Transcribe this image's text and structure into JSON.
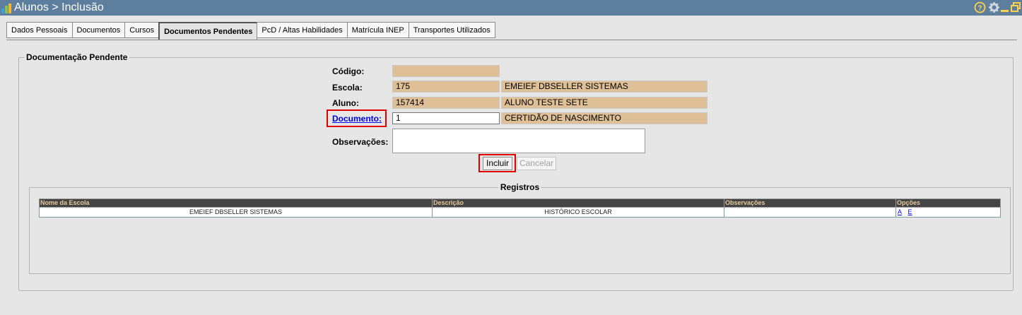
{
  "window": {
    "title": "Alunos > Inclusão",
    "bar_color": "#5d7f9d"
  },
  "tabs": [
    {
      "label": "Dados Pessoais",
      "active": false
    },
    {
      "label": "Documentos",
      "active": false
    },
    {
      "label": "Cursos",
      "active": false
    },
    {
      "label": "Documentos Pendentes",
      "active": true
    },
    {
      "label": "PcD / Altas Habilidades",
      "active": false
    },
    {
      "label": "Matrícula INEP",
      "active": false
    },
    {
      "label": "Transportes Utilizados",
      "active": false
    }
  ],
  "form": {
    "legend": "Documentação Pendente",
    "codigo_label": "Código:",
    "codigo_value": "",
    "escola_label": "Escola:",
    "escola_code": "175",
    "escola_name": "EMEIEF DBSELLER SISTEMAS",
    "aluno_label": "Aluno:",
    "aluno_code": "157414",
    "aluno_name": "ALUNO TESTE SETE",
    "documento_label": "Documento:",
    "documento_code": "1",
    "documento_name": "CERTIDÃO DE NASCIMENTO",
    "observacoes_label": "Observações:",
    "observacoes_value": "",
    "incluir_label": "Incluir",
    "cancelar_label": "Cancelar",
    "readonly_color": "#dfbf95"
  },
  "registros": {
    "legend": "Registros",
    "columns": [
      "Nome da Escola",
      "Descrição",
      "Observações",
      "Opções"
    ],
    "rows": [
      {
        "escola": "EMEIEF DBSELLER SISTEMAS",
        "descricao": "HISTÓRICO ESCOLAR",
        "observacoes": "",
        "opt_a": "A",
        "opt_e": "E"
      }
    ]
  },
  "icons": {
    "logo": "app-logo-icon",
    "help": "help-icon",
    "settings": "gear-icon",
    "minimize": "minimize-icon",
    "restore": "restore-icon"
  }
}
